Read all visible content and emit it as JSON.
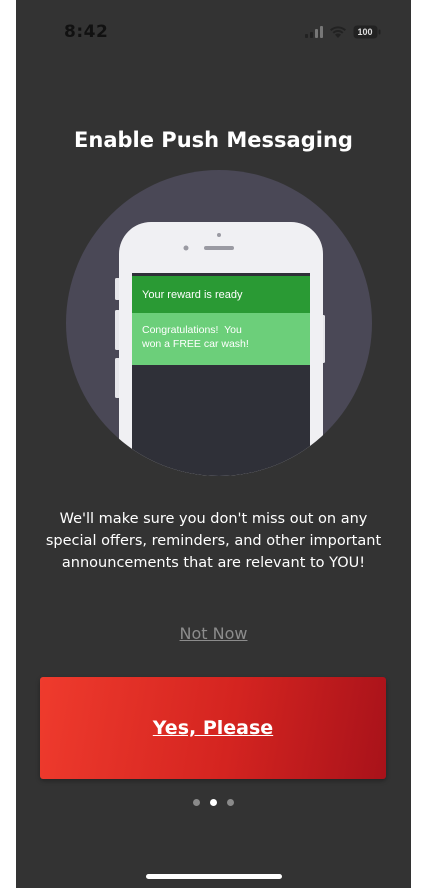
{
  "status_bar": {
    "time": "8:42",
    "battery": "100",
    "icons": [
      "signal-icon",
      "wifi-icon",
      "battery-icon"
    ]
  },
  "title": "Enable Push Messaging",
  "illustration": {
    "notification_title": "Your reward is ready",
    "notification_body_line1": "Congratulations!  You",
    "notification_body_line2": "won a FREE car wash!"
  },
  "description": "We'll make sure you don't miss out on any special offers, reminders, and other important announcements that are relevant to YOU!",
  "not_now_label": "Not Now",
  "yes_label": "Yes, Please",
  "pager": {
    "pages": 3,
    "active": 1
  },
  "colors": {
    "background": "#333333",
    "accent_red": "#d42420",
    "notification_dark_green": "#2a9a34",
    "notification_light_green": "#6ccf7a"
  }
}
